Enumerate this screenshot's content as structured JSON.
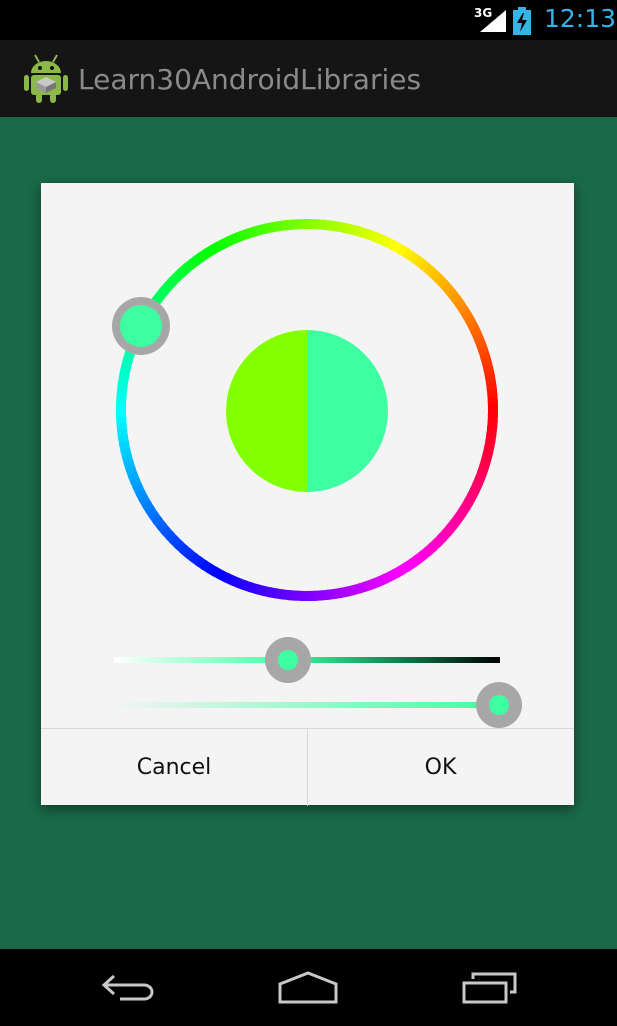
{
  "status_bar": {
    "network": "3G",
    "time": "12:13",
    "accent_color": "#33b5e5"
  },
  "action_bar": {
    "title": "Learn30AndroidLibraries",
    "icon": "android-app-icon"
  },
  "color_picker": {
    "hue_ring_colors": [
      "#ff0000",
      "#ffff00",
      "#00ff00",
      "#00ffff",
      "#0000ff",
      "#ff00ff"
    ],
    "selected_color": "#3dffa2",
    "old_color": "#82ff00",
    "new_color": "#3dffa2",
    "saturation_value_level": 0.45,
    "opacity_level": 1.0
  },
  "dialog": {
    "cancel_label": "Cancel",
    "ok_label": "OK"
  },
  "navigation": {
    "icons": [
      "back-icon",
      "home-icon",
      "recent-apps-icon"
    ]
  },
  "colors": {
    "background": "#1a6a47",
    "dialog_background": "#f4f4f4",
    "thumb_ring": "#a7a7a7"
  }
}
